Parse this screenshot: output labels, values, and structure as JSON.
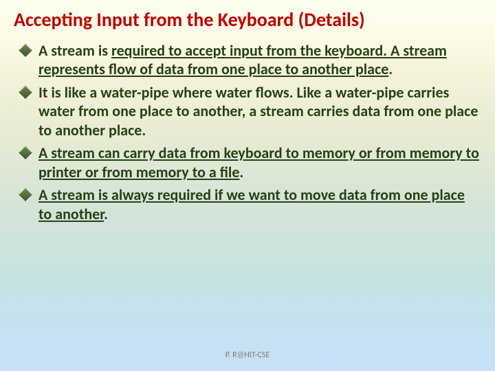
{
  "title": "Accepting Input from the Keyboard (Details)",
  "bullets": {
    "b1_part1_u": "required to accept input from the keyboard. A stream represents flow of data from one place to another place",
    "b2": "It is like a water-pipe where water flows. Like a water-pipe carries water from one place to another, a stream carries data from one place to another place.",
    "b3_u": "A stream can carry data from keyboard to memory or from memory to printer or from memory to a file",
    "b4_u": "A stream is always required if we want to move data from one place to another"
  },
  "prefix": {
    "b1": "A stream is "
  },
  "footer": "P. R@HIT-CSE"
}
